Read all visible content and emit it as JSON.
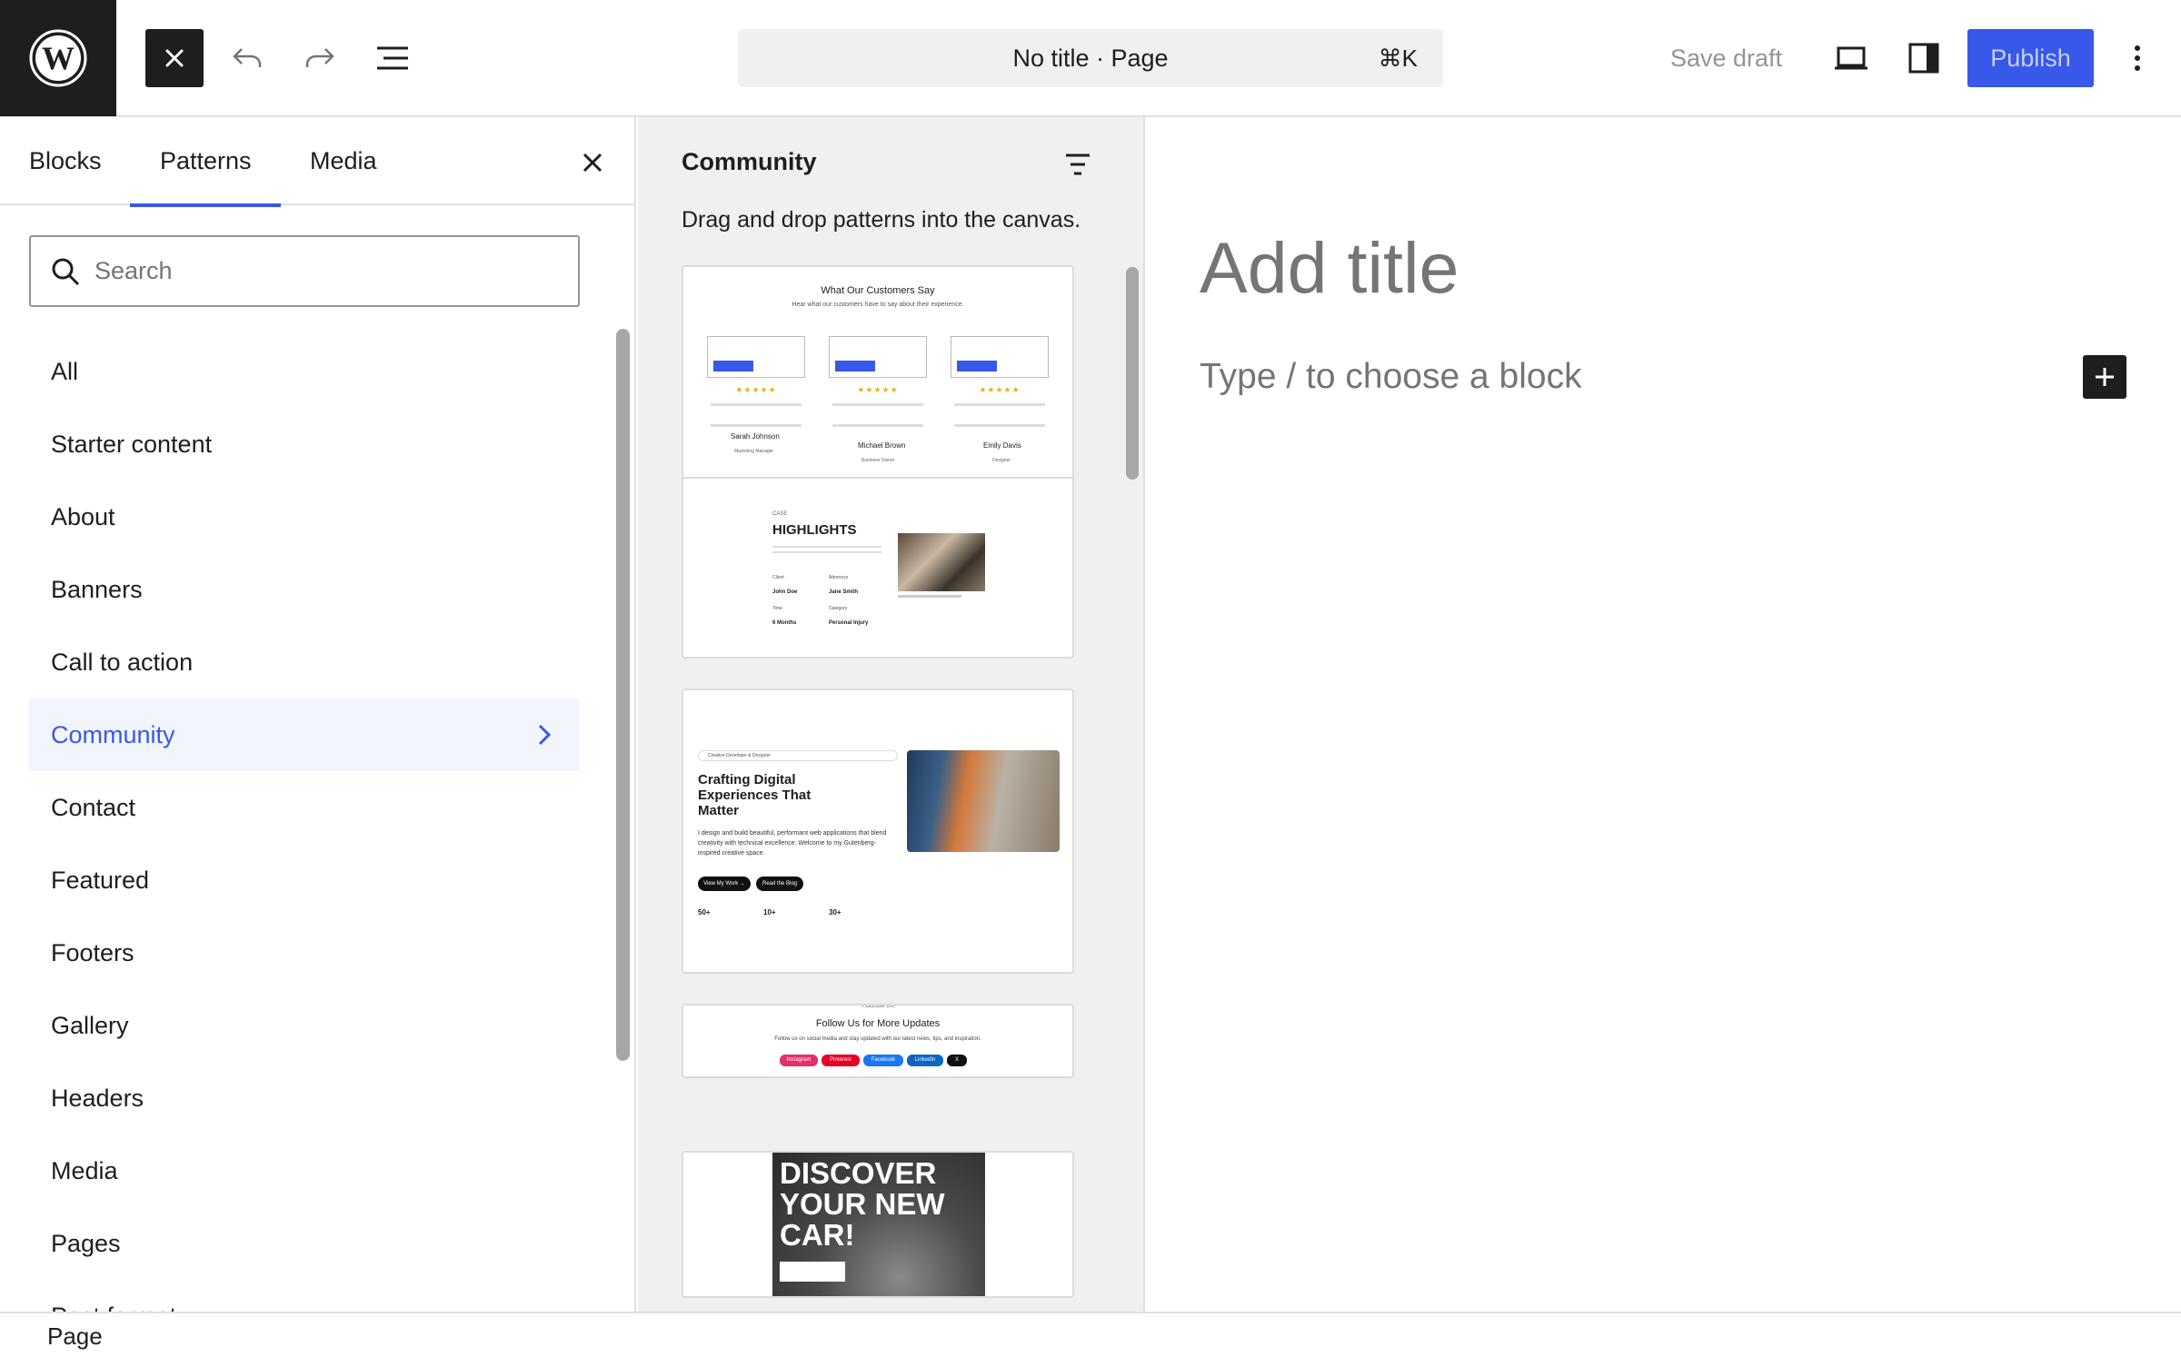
{
  "header": {
    "document_title": "No title · Page",
    "command_shortcut": "⌘K",
    "save_draft_label": "Save draft",
    "publish_label": "Publish"
  },
  "inserter": {
    "tabs": [
      {
        "label": "Blocks"
      },
      {
        "label": "Patterns"
      },
      {
        "label": "Media"
      }
    ],
    "active_tab": "Patterns",
    "search_placeholder": "Search",
    "categories": [
      {
        "label": "All"
      },
      {
        "label": "Starter content"
      },
      {
        "label": "About"
      },
      {
        "label": "Banners"
      },
      {
        "label": "Call to action"
      },
      {
        "label": "Community"
      },
      {
        "label": "Contact"
      },
      {
        "label": "Featured"
      },
      {
        "label": "Footers"
      },
      {
        "label": "Gallery"
      },
      {
        "label": "Headers"
      },
      {
        "label": "Media"
      },
      {
        "label": "Pages"
      },
      {
        "label": "Post format"
      }
    ],
    "active_category": "Community"
  },
  "pattern_panel": {
    "title": "Community",
    "description": "Drag and drop patterns into the canvas.",
    "testimonials": {
      "heading": "What Our Customers Say",
      "subheading": "Hear what our customers have to say about their experience.",
      "people": [
        {
          "name": "Sarah Johnson",
          "role": "Marketing Manager"
        },
        {
          "name": "Michael Brown",
          "role": "Business Owner"
        },
        {
          "name": "Emily Davis",
          "role": "Designer"
        }
      ]
    },
    "case": {
      "eyebrow": "CASE",
      "heading": "HIGHLIGHTS",
      "fields": [
        {
          "label": "Client",
          "value": "John Doe"
        },
        {
          "label": "Attorneys",
          "value": "Jane Smith"
        },
        {
          "label": "Time",
          "value": "6 Months"
        },
        {
          "label": "Category",
          "value": "Personal Injury"
        }
      ]
    },
    "portfolio": {
      "tag": "Creative Developer & Designer",
      "heading": "Crafting Digital Experiences That Matter",
      "body": "I design and build beautiful, performant web applications that blend creativity with technical excellence. Welcome to my Gutenberg-inspired creative space.",
      "buttons": [
        "View My Work →",
        "Read the Blog"
      ],
      "stats": [
        "50+",
        "10+",
        "30+"
      ]
    },
    "follow": {
      "eyebrow": "FOLLOW US",
      "heading": "Follow Us for More Updates",
      "body": "Follow us on social media and stay updated with our latest news, tips, and inspiration.",
      "networks": [
        "Instagram",
        "Pinterest",
        "Facebook",
        "LinkedIn",
        "X"
      ]
    },
    "car": {
      "line1": "DISCOVER",
      "line2": "YOUR NEW",
      "line3": "CAR!"
    }
  },
  "canvas": {
    "title_placeholder": "Add title",
    "block_placeholder": "Type / to choose a block"
  },
  "footer": {
    "breadcrumb": "Page"
  },
  "colors": {
    "accent": "#3858e9",
    "dark": "#1e1e1e",
    "panel_bg": "#f0f0f0"
  }
}
